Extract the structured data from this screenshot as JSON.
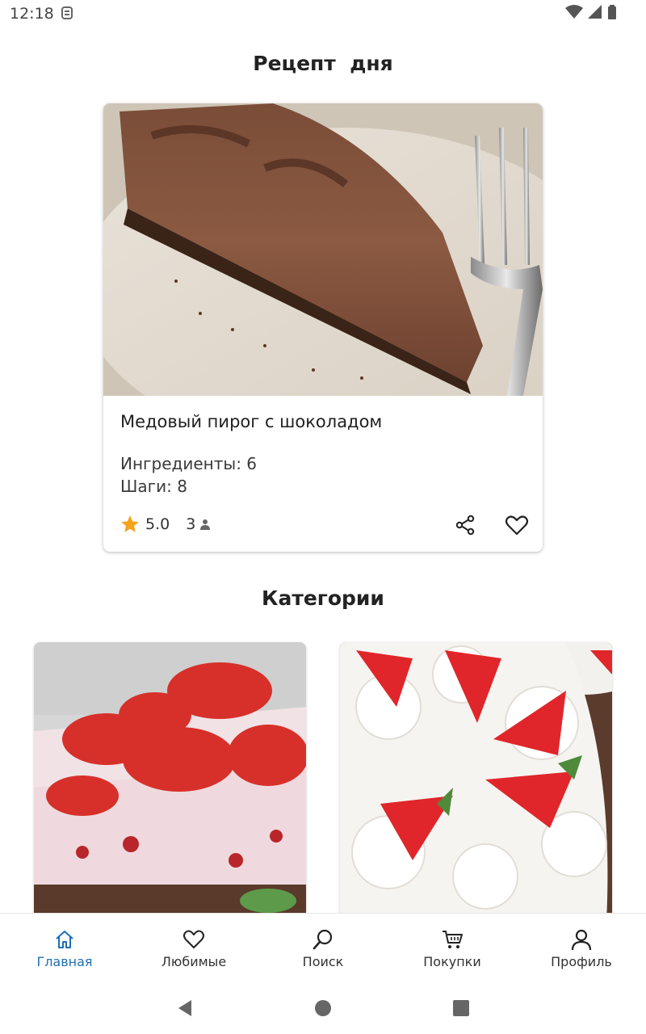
{
  "status_bar": {
    "time": "12:18"
  },
  "recipe_of_day": {
    "title": "Рецепт  дня",
    "name": "Медовый пирог с шоколадом",
    "ingredients": "Ингредиенты: 6",
    "steps": "Шаги: 8",
    "rating": "5.0",
    "reviews": "3"
  },
  "categories": {
    "title": "Категории"
  },
  "bottom_nav": {
    "items": [
      {
        "label": "Главная",
        "icon": "home-icon"
      },
      {
        "label": "Любимые",
        "icon": "heart-icon"
      },
      {
        "label": "Поиск",
        "icon": "search-icon"
      },
      {
        "label": "Покупки",
        "icon": "cart-icon"
      },
      {
        "label": "Профиль",
        "icon": "profile-icon"
      }
    ],
    "active_color": "#1f6fb5"
  },
  "colors": {
    "star": "#f4a31a",
    "accent": "#1f6fb5"
  }
}
